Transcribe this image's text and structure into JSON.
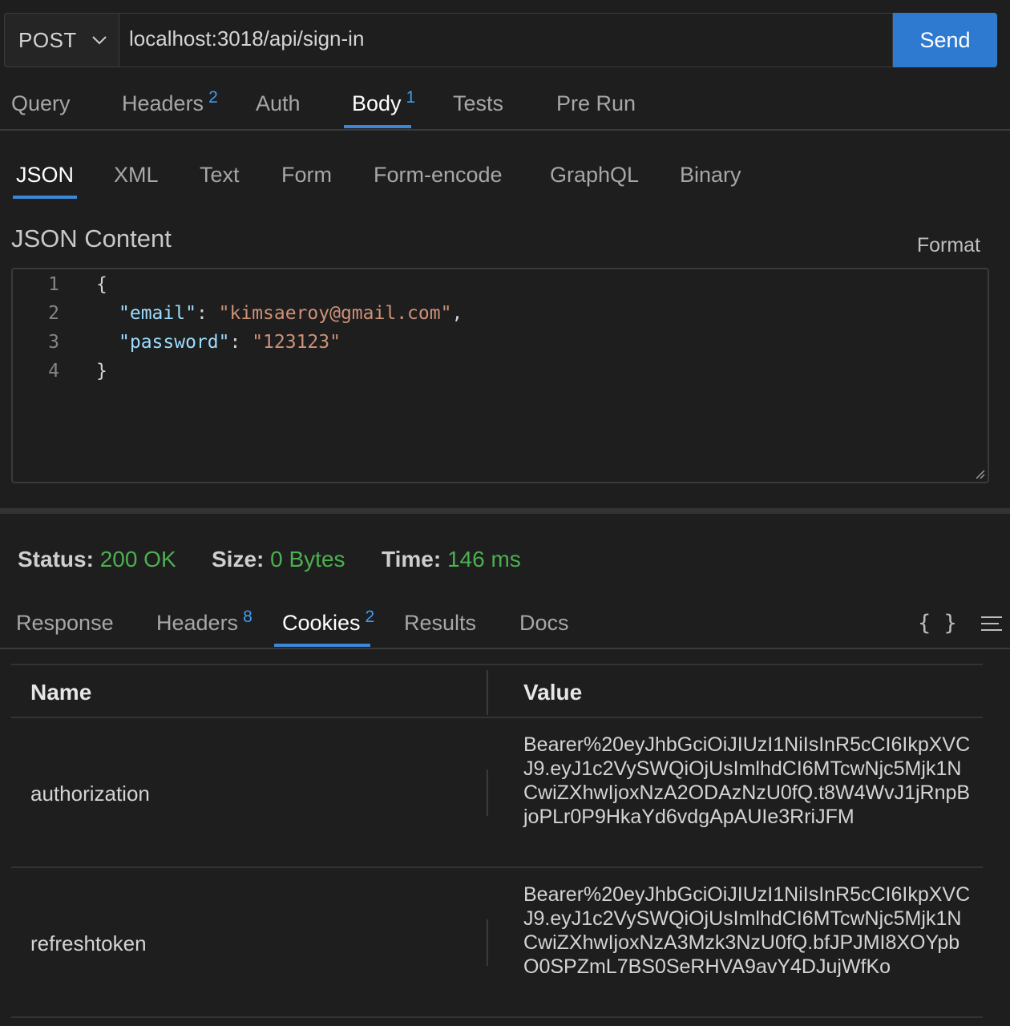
{
  "request": {
    "method": "POST",
    "url": "localhost:3018/api/sign-in",
    "send_label": "Send"
  },
  "request_tabs": {
    "query": "Query",
    "headers": "Headers",
    "headers_count": "2",
    "auth": "Auth",
    "body": "Body",
    "body_count": "1",
    "tests": "Tests",
    "pre_run": "Pre Run"
  },
  "body_types": {
    "json": "JSON",
    "xml": "XML",
    "text": "Text",
    "form": "Form",
    "form_encode": "Form-encode",
    "graphql": "GraphQL",
    "binary": "Binary"
  },
  "editor": {
    "title": "JSON Content",
    "format_label": "Format",
    "line_numbers": [
      "1",
      "2",
      "3",
      "4"
    ],
    "open_brace": "{",
    "email_key": "\"email\"",
    "email_value": "\"kimsaeroy@gmail.com\"",
    "password_key": "\"password\"",
    "password_value": "\"123123\"",
    "close_brace": "}"
  },
  "status": {
    "status_label": "Status:",
    "status_value": "200 OK",
    "size_label": "Size:",
    "size_value": "0 Bytes",
    "time_label": "Time:",
    "time_value": "146 ms"
  },
  "response_tabs": {
    "response": "Response",
    "headers": "Headers",
    "headers_count": "8",
    "cookies": "Cookies",
    "cookies_count": "2",
    "results": "Results",
    "docs": "Docs",
    "braces": "{ }"
  },
  "cookies_table": {
    "columns": [
      "Name",
      "Value"
    ],
    "rows": [
      {
        "name": "authorization",
        "value": "Bearer%20eyJhbGciOiJIUzI1NiIsInR5cCI6IkpXVCJ9.eyJ1c2VySWQiOjUsImlhdCI6MTcwNjc5Mjk1NCwiZXhwIjoxNzA2ODAzNzU0fQ.t8W4WvJ1jRnpBjoPLr0P9HkaYd6vdgApAUIe3RriJFM"
      },
      {
        "name": "refreshtoken",
        "value": "Bearer%20eyJhbGciOiJIUzI1NiIsInR5cCI6IkpXVCJ9.eyJ1c2VySWQiOjUsImlhdCI6MTcwNjc5Mjk1NCwiZXhwIjoxNzA3Mzk3NzU0fQ.bfJPJMI8XOYpbO0SPZmL7BS0SeRHVA9avY4DJujWfKo"
      }
    ]
  },
  "colors": {
    "send_button": "#2f7ad1",
    "status_green": "#4caf50",
    "badge_blue": "#3e9cf0",
    "json_key": "#9cdcfe",
    "json_string": "#ce9178"
  },
  "icons": {
    "method_dropdown": "chevron-down-icon",
    "editor_resize": "resize-handle-icon",
    "response_menu": "menu-lines-icon"
  }
}
